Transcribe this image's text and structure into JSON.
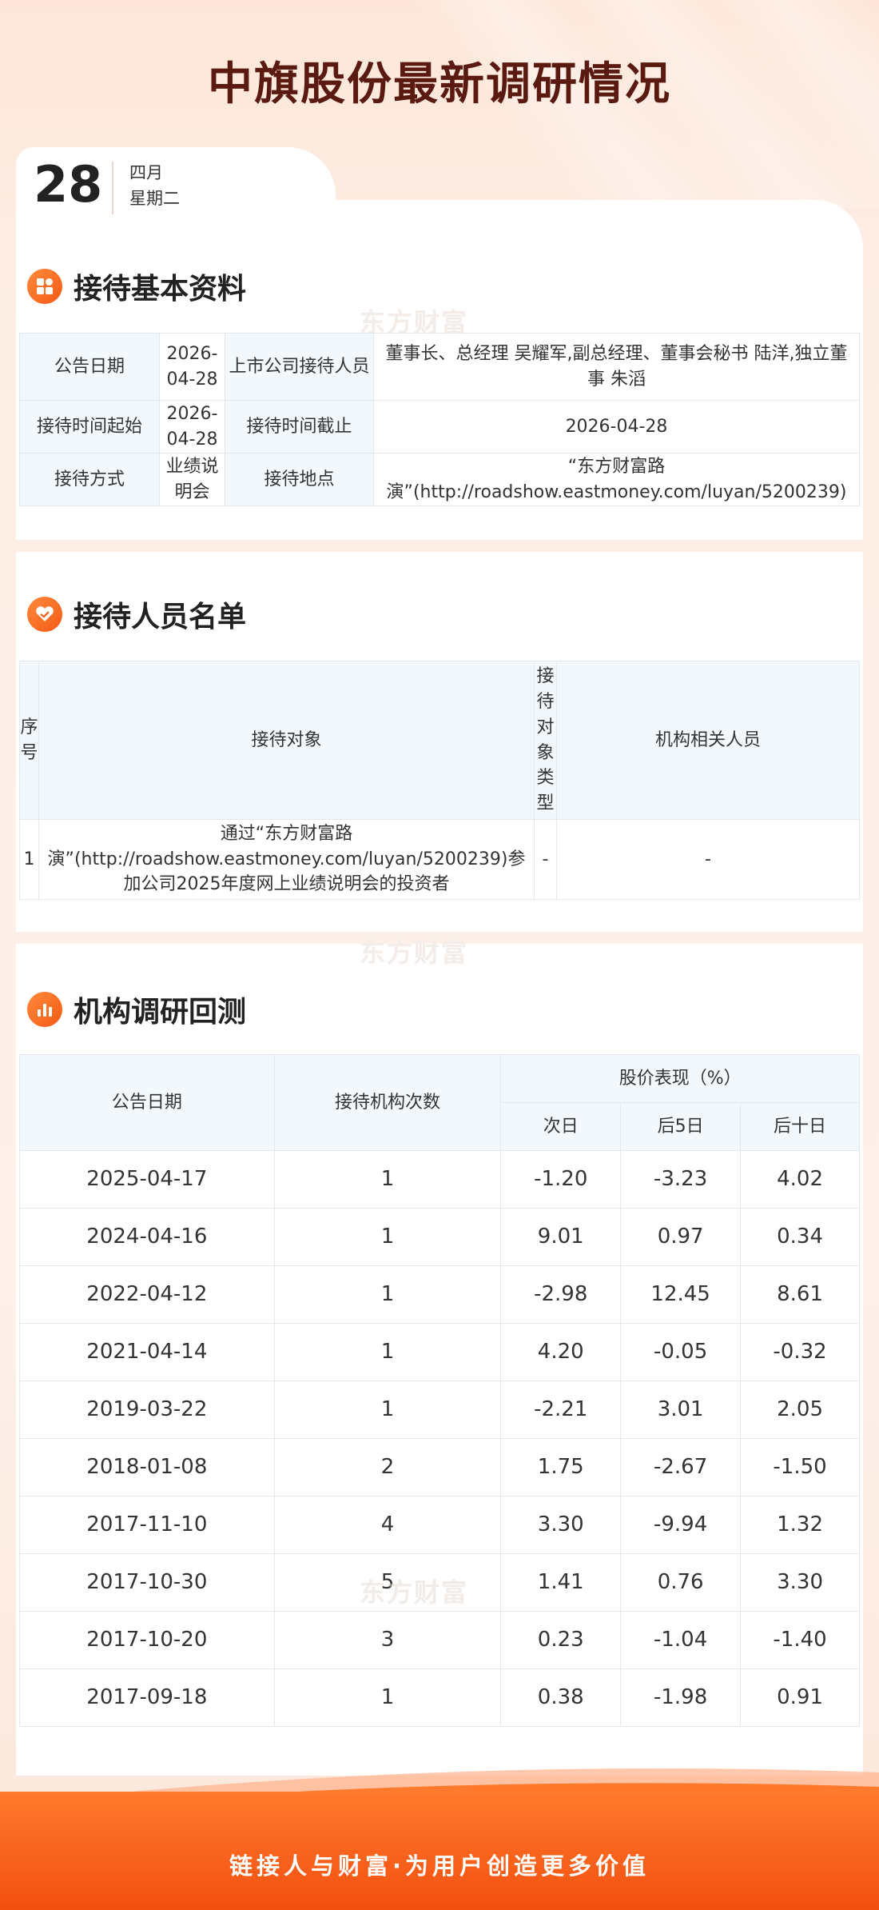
{
  "title": "中旗股份最新调研情况",
  "date": {
    "day": "28",
    "month": "四月",
    "weekday": "星期二"
  },
  "watermark": "东方财富",
  "basic": {
    "title": "接待基本资料",
    "rows": [
      [
        "公告日期",
        "2026-04-28",
        "上市公司接待人员",
        "董事长、总经理 吴耀军,副总经理、董事会秘书 陆洋,独立董事 朱滔"
      ],
      [
        "接待时间起始",
        "2026-04-28",
        "接待时间截止",
        "2026-04-28"
      ],
      [
        "接待方式",
        "业绩说明会",
        "接待地点",
        "“东方财富路演”(http://roadshow.eastmoney.com/luyan/5200239)"
      ]
    ]
  },
  "people": {
    "title": "接待人员名单",
    "headers": [
      "序号",
      "接待对象",
      "接待对象类型",
      "机构相关人员"
    ],
    "rows": [
      [
        "1",
        "通过“东方财富路演”(http://roadshow.eastmoney.com/luyan/5200239)参加公司2025年度网上业绩说明会的投资者",
        "-",
        "-"
      ]
    ]
  },
  "research": {
    "title": "机构调研回测",
    "headers": {
      "date": "公告日期",
      "count": "接待机构次数",
      "perf": "股价表现（%）",
      "d1": "次日",
      "d5": "后5日",
      "d10": "后十日"
    },
    "rows": [
      [
        "2025-04-17",
        "1",
        "-1.20",
        "-3.23",
        "4.02"
      ],
      [
        "2024-04-16",
        "1",
        "9.01",
        "0.97",
        "0.34"
      ],
      [
        "2022-04-12",
        "1",
        "-2.98",
        "12.45",
        "8.61"
      ],
      [
        "2021-04-14",
        "1",
        "4.20",
        "-0.05",
        "-0.32"
      ],
      [
        "2019-03-22",
        "1",
        "-2.21",
        "3.01",
        "2.05"
      ],
      [
        "2018-01-08",
        "2",
        "1.75",
        "-2.67",
        "-1.50"
      ],
      [
        "2017-11-10",
        "4",
        "3.30",
        "-9.94",
        "1.32"
      ],
      [
        "2017-10-30",
        "5",
        "1.41",
        "0.76",
        "3.30"
      ],
      [
        "2017-10-20",
        "3",
        "0.23",
        "-1.04",
        "-1.40"
      ],
      [
        "2017-09-18",
        "1",
        "0.38",
        "-1.98",
        "0.91"
      ]
    ]
  },
  "footer": "链接人与财富·为用户创造更多价值",
  "colors": {
    "accent": "#f45a14",
    "title": "#5a1a10",
    "label_bg": "#f3f8fc"
  }
}
